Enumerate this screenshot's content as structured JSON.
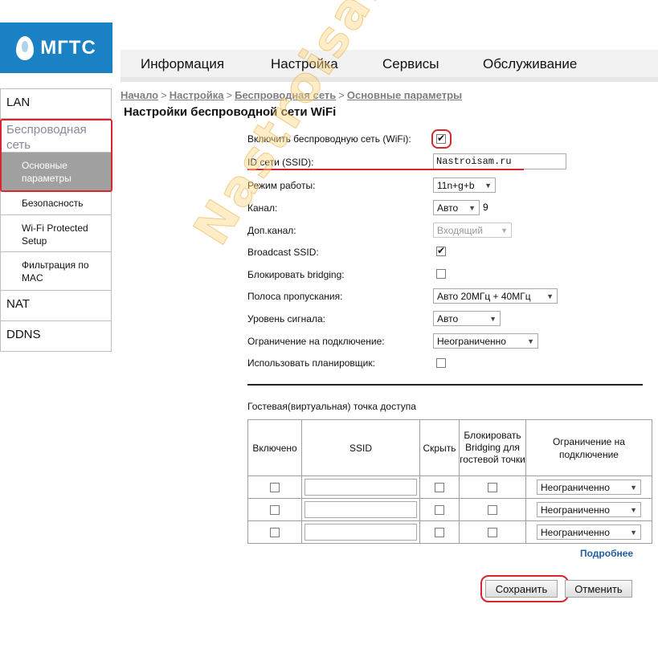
{
  "logo": {
    "text": "МГТС",
    "color": "#1a82c4"
  },
  "topnav": [
    "Информация",
    "Настройка",
    "Сервисы",
    "Обслуживание"
  ],
  "sidebar": {
    "lan": "LAN",
    "wireless": "Беспроводная сеть",
    "basic": "Основные параметры",
    "security": "Безопасность",
    "wps": "Wi-Fi Protected Setup",
    "mac": "Фильтрация по MAC",
    "nat": "NAT",
    "ddns": "DDNS"
  },
  "breadcrumb": {
    "home": "Начало",
    "setup": "Настройка",
    "wireless": "Беспроводная сеть",
    "basic": "Основные параметры",
    "separator": ">"
  },
  "page_title": "Настройки беспроводной сети WiFi",
  "form": {
    "enable_wifi": {
      "label": "Включить беспроводную сеть (WiFi):",
      "checked": true
    },
    "ssid": {
      "label": "ID сети (SSID):",
      "value": "Nastroisam.ru"
    },
    "mode": {
      "label": "Режим работы:",
      "value": "11n+g+b"
    },
    "channel": {
      "label": "Канал:",
      "value": "Авто",
      "current": "9"
    },
    "ext_channel": {
      "label": "Доп.канал:",
      "value": "Входящий"
    },
    "broadcast": {
      "label": "Broadcast SSID:",
      "checked": true
    },
    "block_bridging": {
      "label": "Блокировать bridging:",
      "checked": false
    },
    "bandwidth": {
      "label": "Полоса пропускания:",
      "value": "Авто 20МГц + 40МГц"
    },
    "signal": {
      "label": "Уровень сигнала:",
      "value": "Авто"
    },
    "conn_limit": {
      "label": "Ограничение на подключение:",
      "value": "Неограниченно"
    },
    "scheduler": {
      "label": "Использовать планировщик:",
      "checked": false
    }
  },
  "guest": {
    "title": "Гостевая(виртуальная) точка доступа",
    "headers": {
      "enabled": "Включено",
      "ssid": "SSID",
      "hide": "Скрыть",
      "block": "Блокировать Bridging для гостевой точки",
      "limit": "Ограничение на подключение"
    },
    "rows": [
      {
        "limit": "Неограниченно"
      },
      {
        "limit": "Неограниченно"
      },
      {
        "limit": "Неограниченно"
      }
    ]
  },
  "more_link": "Подробнее",
  "buttons": {
    "save": "Сохранить",
    "cancel": "Отменить"
  },
  "watermark": "Nastroisam.ru",
  "colors": {
    "highlight": "#d7262d",
    "link": "#1f5fa0",
    "active_sub": "#a0a0a0"
  }
}
